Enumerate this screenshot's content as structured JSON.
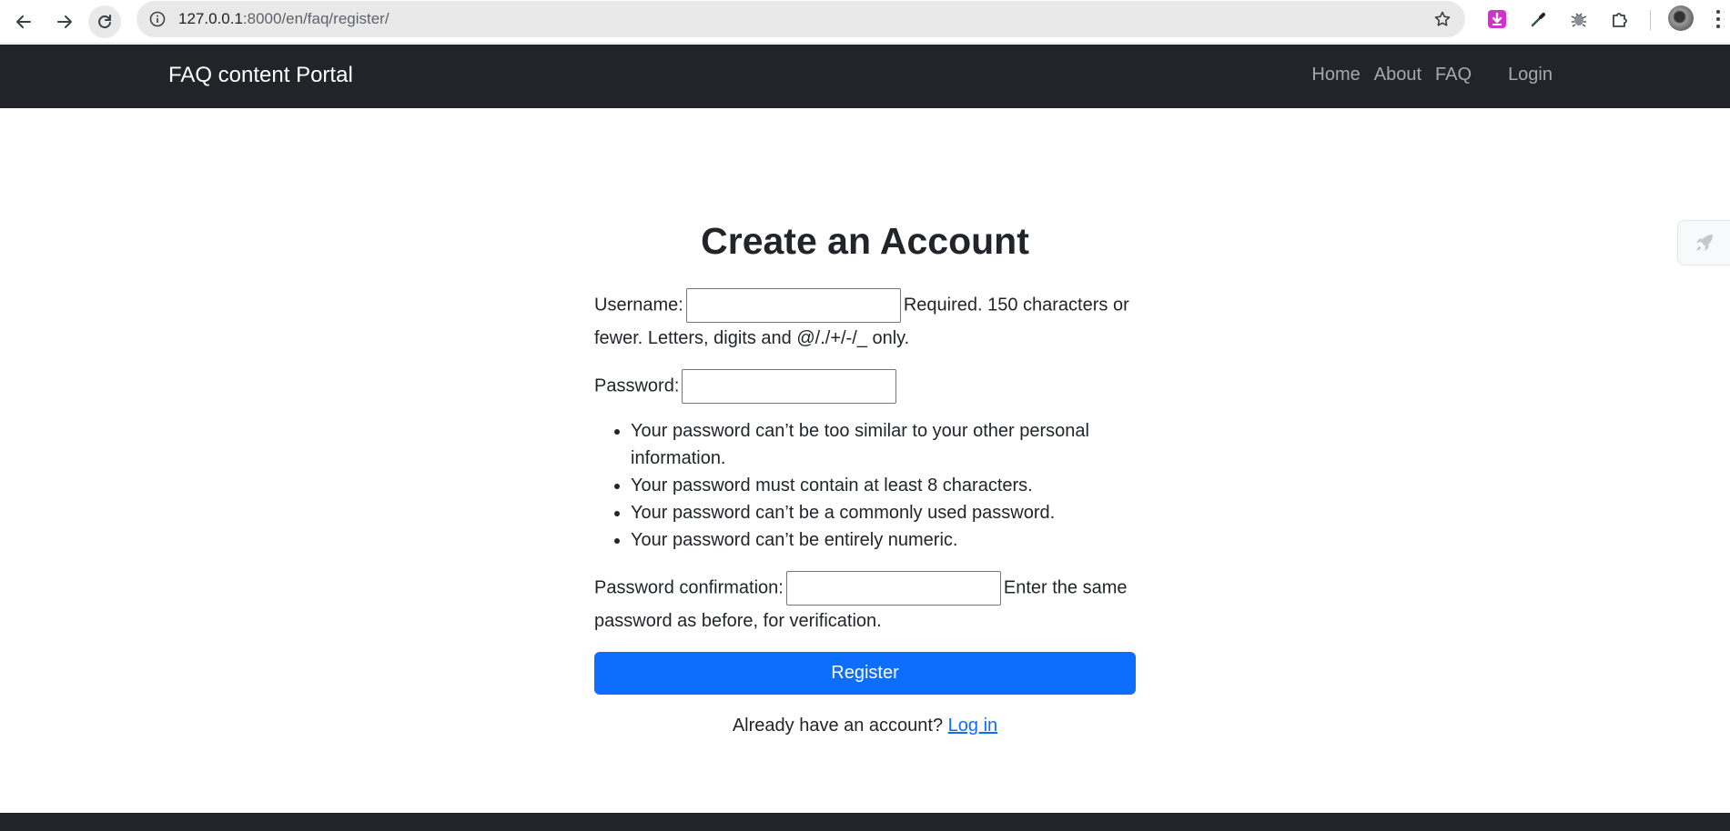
{
  "browser": {
    "url_host": "127.0.0.1",
    "url_rest": ":8000/en/faq/register/"
  },
  "navbar": {
    "brand": "FAQ content Portal",
    "links": [
      "Home",
      "About",
      "FAQ",
      "Login"
    ]
  },
  "form": {
    "title": "Create an Account",
    "username_label": "Username:",
    "username_help_a": "Required. 150 characters or",
    "username_help_b": "fewer. Letters, digits and @/./+/-/_ only.",
    "password_label": "Password:",
    "password_rules": [
      "Your password can’t be too similar to your other personal information.",
      "Your password must contain at least 8 characters.",
      "Your password can’t be a commonly used password.",
      "Your password can’t be entirely numeric."
    ],
    "confirm_label": "Password confirmation:",
    "confirm_help_a": "Enter the same",
    "confirm_help_b": "password as before, for verification.",
    "submit_label": "Register",
    "login_prompt": "Already have an account?",
    "login_link": "Log in"
  },
  "icons": [
    "back-arrow-icon",
    "forward-arrow-icon",
    "reload-icon",
    "site-info-icon",
    "bookmark-star-icon",
    "download-extension-icon",
    "eyedropper-extension-icon",
    "bug-extension-icon",
    "extensions-puzzle-icon",
    "profile-avatar",
    "menu-kebab-icon",
    "rocket-icon"
  ],
  "colors": {
    "navbar_bg": "#212529",
    "primary": "#0d6efd"
  }
}
